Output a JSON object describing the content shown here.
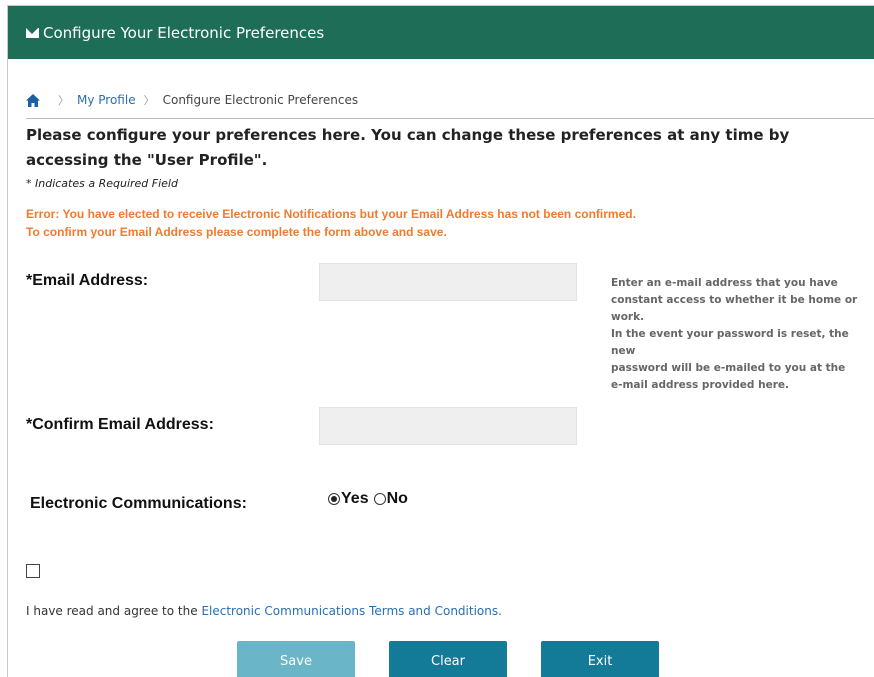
{
  "header": {
    "title": "Configure Your Electronic Preferences",
    "icon": "envelope-icon"
  },
  "breadcrumb": {
    "home_icon": "home-icon",
    "items": [
      "My Profile",
      "Configure Electronic Preferences"
    ]
  },
  "intro": "Please configure your preferences here. You can change these preferences at any time by accessing the \"User Profile\".",
  "required_note": "* Indicates a Required Field",
  "error": {
    "line1": "Error: You have elected to receive Electronic Notifications but your Email Address has not been confirmed.",
    "line2": "To confirm your Email Address please complete the form above and save."
  },
  "form": {
    "email_label": "*Email Address:",
    "email_value": "",
    "confirm_label": "*Confirm Email Address:",
    "confirm_value": "",
    "comm_label": "Electronic Communications:",
    "comm_options": [
      "Yes",
      "No"
    ],
    "comm_selected": "Yes"
  },
  "help": {
    "line1": "Enter an e-mail address that you have",
    "line2": "constant access to whether it be home or",
    "line3": "work.",
    "line4": "In the event your password is reset, the new",
    "line5": "password will be e-mailed to you at the",
    "line6": "e-mail address provided here."
  },
  "agree": {
    "checked": false,
    "text": "I have read and agree to the ",
    "link": "Electronic Communications Terms and Conditions."
  },
  "buttons": {
    "save": "Save",
    "clear": "Clear",
    "exit": "Exit"
  },
  "colors": {
    "header_bg": "#1e6e57",
    "error": "#f07a30",
    "link": "#2a6fb0",
    "button": "#137a98",
    "button_disabled": "#6bb5c8"
  }
}
